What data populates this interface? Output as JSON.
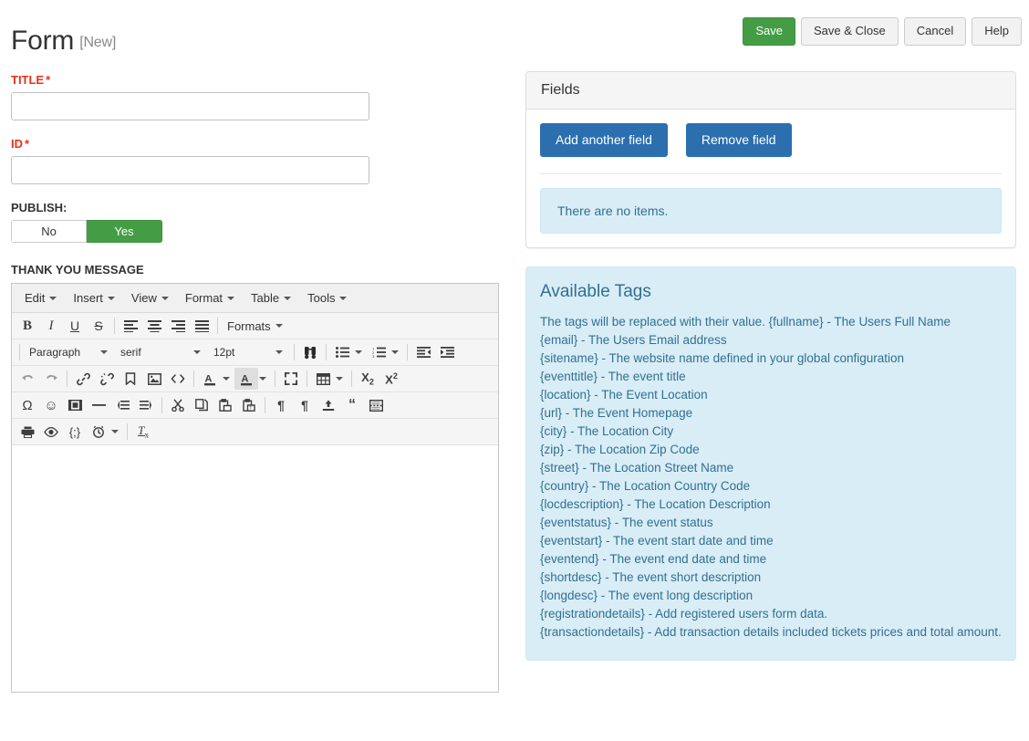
{
  "header": {
    "title": "Form",
    "state_badge": "[New]",
    "buttons": [
      {
        "label": "Save",
        "name": "save-button",
        "style": "green"
      },
      {
        "label": "Save & Close",
        "name": "save-and-close-button",
        "style": "default"
      },
      {
        "label": "Cancel",
        "name": "cancel-button",
        "style": "default"
      },
      {
        "label": "Help",
        "name": "help-button",
        "style": "default"
      }
    ]
  },
  "form": {
    "title_field": {
      "label": "TITLE",
      "required_marker": "*",
      "value": "",
      "placeholder": ""
    },
    "id_field": {
      "label": "ID",
      "required_marker": "*",
      "value": "",
      "placeholder": ""
    },
    "publish": {
      "label": "PUBLISH:",
      "options": [
        "No",
        "Yes"
      ],
      "selected": "Yes"
    },
    "thank_you_message": {
      "label": "THANK YOU MESSAGE",
      "content": ""
    }
  },
  "editor": {
    "menubar": [
      "Edit",
      "Insert",
      "View",
      "Format",
      "Table",
      "Tools"
    ],
    "row1": {
      "bold": "B",
      "italic": "I",
      "underline": "U",
      "strikethrough": "S",
      "formats_label": "Formats"
    },
    "row2": {
      "block_format": "Paragraph",
      "font_family": "serif",
      "font_size": "12pt"
    },
    "icon_names_row1": [
      "bold-icon",
      "italic-icon",
      "underline-icon",
      "strikethrough-icon",
      "align-left-icon",
      "align-center-icon",
      "align-right-icon",
      "align-justify-icon"
    ],
    "icon_names_row2": [
      "search-replace-icon",
      "bullet-list-icon",
      "numbered-list-icon",
      "outdent-icon",
      "indent-icon"
    ],
    "icon_names_row3": [
      "undo-icon",
      "redo-icon",
      "link-icon",
      "unlink-icon",
      "anchor-icon",
      "image-icon",
      "source-code-icon",
      "text-color-icon",
      "background-color-icon",
      "fullscreen-icon",
      "table-icon",
      "subscript-icon",
      "superscript-icon"
    ],
    "icon_names_row4": [
      "special-character-icon",
      "emoticon-icon",
      "media-icon",
      "horizontal-rule-icon",
      "ltr-icon",
      "rtl-icon",
      "cut-icon",
      "copy-icon",
      "paste-icon",
      "paste-text-icon",
      "show-blocks-icon",
      "visual-chars-icon",
      "insert-file-icon",
      "blockquote-icon",
      "page-break-icon"
    ],
    "icon_names_row5": [
      "print-icon",
      "preview-icon",
      "code-sample-icon",
      "insert-datetime-icon",
      "remove-format-icon"
    ]
  },
  "fields_panel": {
    "heading": "Fields",
    "add_button": "Add another field",
    "remove_button": "Remove field",
    "empty_message": "There are no items."
  },
  "available_tags": {
    "title": "Available Tags",
    "intro": "The tags will be replaced with their value. {fullname} - The Users Full Name",
    "lines": [
      "{email} - The Users Email address",
      "{sitename} - The website name defined in your global configuration",
      "{eventtitle} - The event title",
      "{location} - The Event Location",
      "{url} - The Event Homepage",
      "{city} - The Location City",
      "{zip} - The Location Zip Code",
      "{street} - The Location Street Name",
      "{country} - The Location Country Code",
      "{locdescription} - The Location Description",
      "{eventstatus} - The event status",
      "{eventstart} - The event start date and time",
      "{eventend} - The event end date and time",
      "{shortdesc} - The event short description",
      "{longdesc} - The event long description",
      "{registrationdetails} - Add registered users form data.",
      "{transactiondetails} - Add transaction details included tickets prices and total amount."
    ]
  },
  "colors": {
    "save_green": "#449d44",
    "primary_blue": "#2b6fae",
    "info_bg": "#d9edf7",
    "info_text": "#31708f",
    "required_red": "#e8301c"
  }
}
